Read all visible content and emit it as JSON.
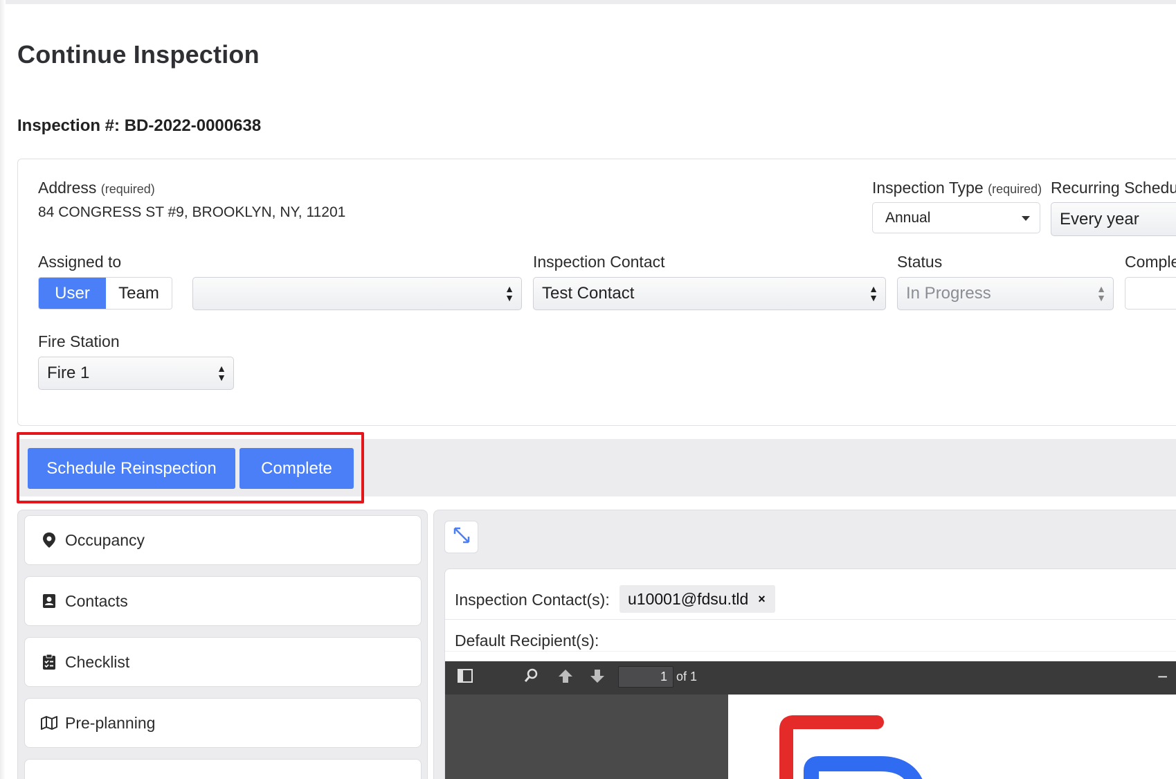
{
  "page": {
    "title": "Continue Inspection",
    "inspection_number": "Inspection #: BD-2022-0000638"
  },
  "details": {
    "address_label": "Address",
    "address_required": "(required)",
    "address_value": "84 CONGRESS ST #9, BROOKLYN, NY, 11201",
    "inspection_type_label": "Inspection Type",
    "inspection_type_required": "(required)",
    "inspection_type_value": "Annual",
    "recurring_label": "Recurring Schedule",
    "recurring_value": "Every year",
    "assigned_label": "Assigned to",
    "assigned_toggle": [
      "User",
      "Team"
    ],
    "assigned_selected": "User",
    "assignee_value": "",
    "contact_label": "Inspection Contact",
    "contact_value": "Test Contact",
    "status_label": "Status",
    "status_value": "In Progress",
    "completed_label": "Comple",
    "fire_station_label": "Fire Station",
    "fire_station_value": "Fire 1"
  },
  "actions": {
    "schedule_label": "Schedule Reinspection",
    "complete_label": "Complete"
  },
  "sidebar": {
    "items": [
      {
        "label": "Occupancy",
        "icon": "map-pin-icon"
      },
      {
        "label": "Contacts",
        "icon": "contact-card-icon"
      },
      {
        "label": "Checklist",
        "icon": "clipboard-checklist-icon"
      },
      {
        "label": "Pre-planning",
        "icon": "map-icon"
      },
      {
        "label": "",
        "icon": "partial-item-icon"
      }
    ]
  },
  "report": {
    "inspection_contacts_label": "Inspection Contact(s):",
    "contact_chip": "u10001@fdsu.tld",
    "chip_remove": "×",
    "default_recipients_label": "Default Recipient(s):",
    "pdf_page_number": "1",
    "pdf_page_of": "of 1",
    "zoom_out": "−"
  },
  "colors": {
    "primary": "#4a7ff7",
    "highlight": "#e3161b",
    "panel_bg": "#ececef"
  }
}
